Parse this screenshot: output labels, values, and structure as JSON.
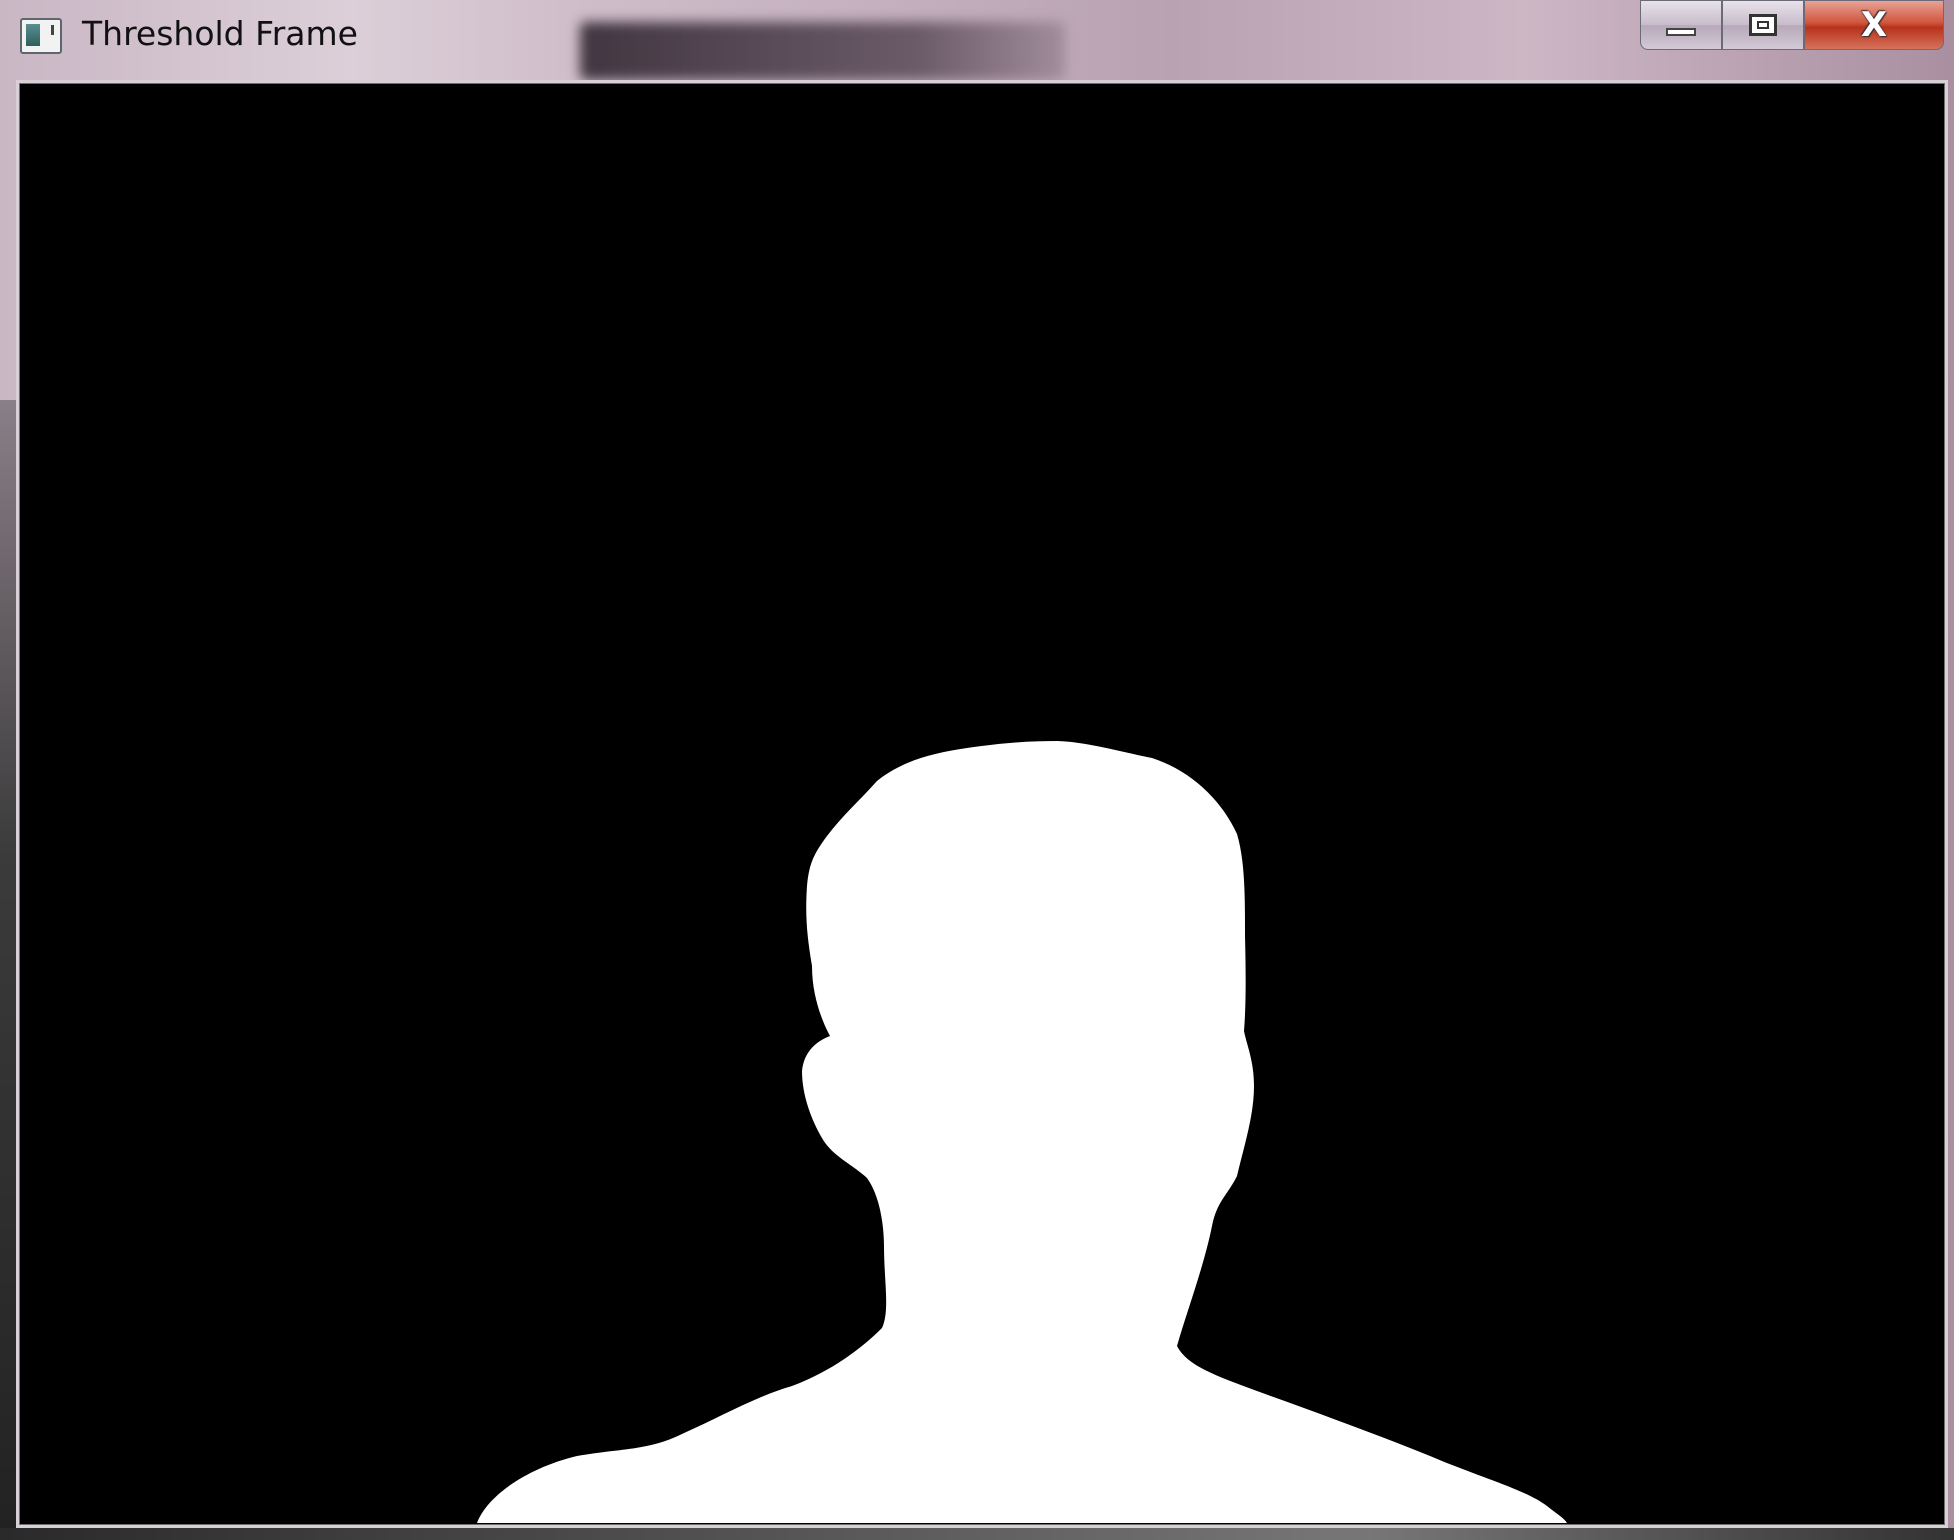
{
  "window": {
    "title": "Threshold Frame",
    "icons": {
      "app": "app-window-icon",
      "minimize": "minimize-icon",
      "maximize": "maximize-icon",
      "close": "close-icon"
    },
    "close_glyph": "X",
    "close_color": "#c8412a"
  },
  "content": {
    "image_kind": "binary threshold mask",
    "background_color": "#000000",
    "foreground_color": "#ffffff",
    "subject": "silhouette of a person's head and shoulders"
  }
}
